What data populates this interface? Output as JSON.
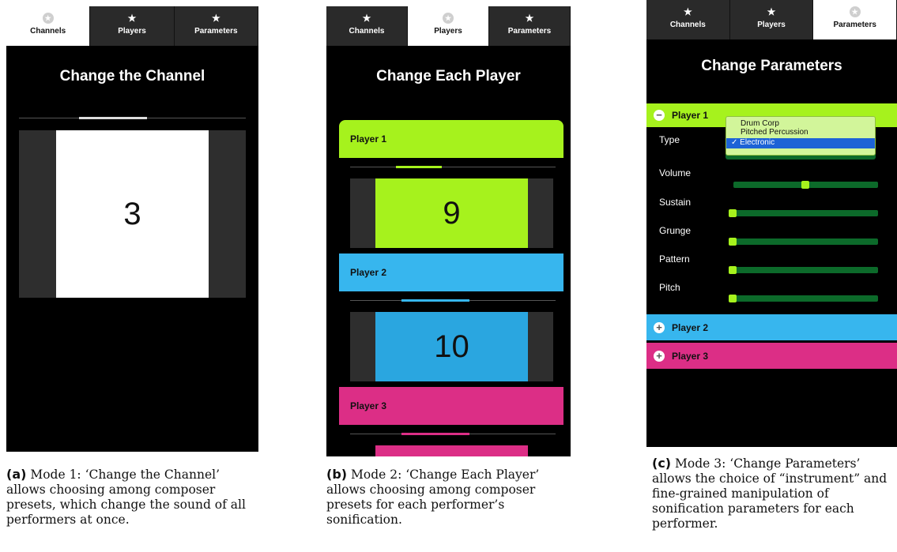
{
  "tabs": [
    {
      "label": "Channels",
      "icon": "star-icon"
    },
    {
      "label": "Players",
      "icon": "star-icon"
    },
    {
      "label": "Parameters",
      "icon": "star-icon"
    }
  ],
  "panel_a": {
    "title": "Change the Channel",
    "channel_value": "3",
    "caption_tag": "(a)",
    "caption_text": " Mode 1: ‘Change the Channel’ allows choosing among composer presets, which change the sound of all performers at once."
  },
  "panel_b": {
    "title": "Change Each Player",
    "players": [
      {
        "label": "Player 1",
        "value": "9",
        "color": "#a6f21d"
      },
      {
        "label": "Player 2",
        "value": "10",
        "color": "#37b6ee"
      },
      {
        "label": "Player 3",
        "value": "",
        "color": "#dc2e86"
      }
    ],
    "caption_tag": "(b)",
    "caption_text": " Mode 2: ‘Change Each Player’ allows choosing among composer presets for each performer’s sonification."
  },
  "panel_c": {
    "title": "Change Parameters",
    "player1_label": "Player 1",
    "player2_label": "Player 2",
    "player3_label": "Player 3",
    "params": [
      "Type",
      "Volume",
      "Sustain",
      "Grunge",
      "Pattern",
      "Pitch"
    ],
    "type_options": [
      "Drum Corp",
      "Pitched Percussion",
      "✓ Electronic"
    ],
    "type_selected": "Electronic",
    "slider_levels": {
      "volume": 0.5,
      "sustain": 0.0,
      "grunge": 0.0,
      "pattern": 0.0,
      "pitch": 0.0
    },
    "caption_tag": "(c)",
    "caption_text": " Mode 3: ‘Change Parameters’ allows the choice of “instrument” and fine-grained manipulation of sonification parameters for each performer."
  },
  "colors": {
    "green": "#a6f21d",
    "blue": "#37b6ee",
    "pink": "#dc2e86",
    "track": "#0c6a2a"
  }
}
